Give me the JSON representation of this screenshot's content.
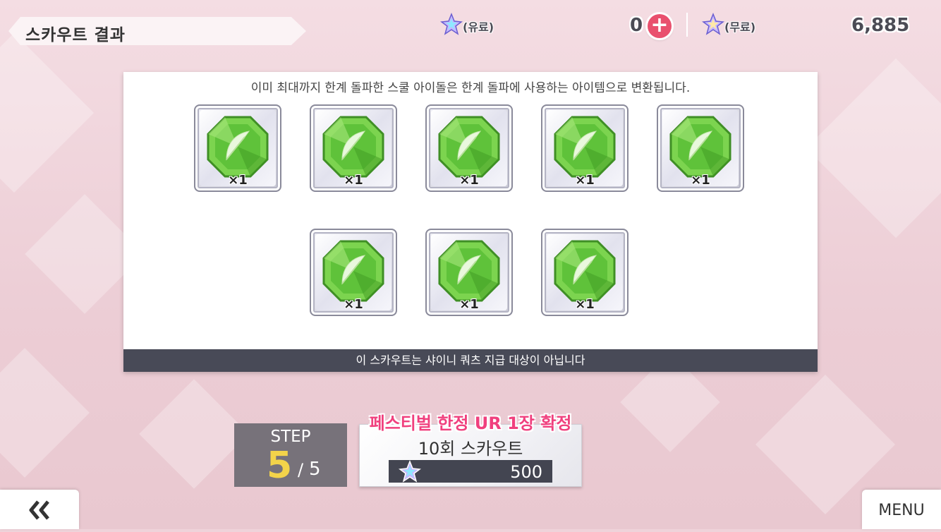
{
  "header": {
    "title": "스카우트 결과",
    "paid_label": "(유료)",
    "paid_count": "0",
    "free_label": "(무료)",
    "free_count": "6,885"
  },
  "panel": {
    "notice": "이미 최대까지 한계 돌파한 스쿨 아이돌은 한계 돌파에 사용하는 아이템으로 변환됩니다.",
    "footer": "이 스카우트는 샤이니 쿼츠 지급 대상이 아닙니다",
    "items": [
      {
        "icon": "green-feather-gem-icon",
        "qty": "×1"
      },
      {
        "icon": "green-feather-gem-icon",
        "qty": "×1"
      },
      {
        "icon": "green-feather-gem-icon",
        "qty": "×1"
      },
      {
        "icon": "green-feather-gem-icon",
        "qty": "×1"
      },
      {
        "icon": "green-feather-gem-icon",
        "qty": "×1"
      },
      {
        "icon": "green-feather-gem-icon",
        "qty": "×1"
      },
      {
        "icon": "green-feather-gem-icon",
        "qty": "×1"
      },
      {
        "icon": "green-feather-gem-icon",
        "qty": "×1"
      }
    ]
  },
  "step": {
    "label": "STEP",
    "current": "5",
    "separator": "/",
    "total": "5"
  },
  "scout": {
    "banner": "페스티벌 한정 UR 1장 확정",
    "title": "10회 스카우트",
    "cost": "500"
  },
  "nav": {
    "menu_label": "MENU"
  },
  "colors": {
    "gem_green": "#5fc23a",
    "festival_pink": "#f0407e",
    "step_yellow": "#f3d34a",
    "plus_red": "#e9506e"
  }
}
